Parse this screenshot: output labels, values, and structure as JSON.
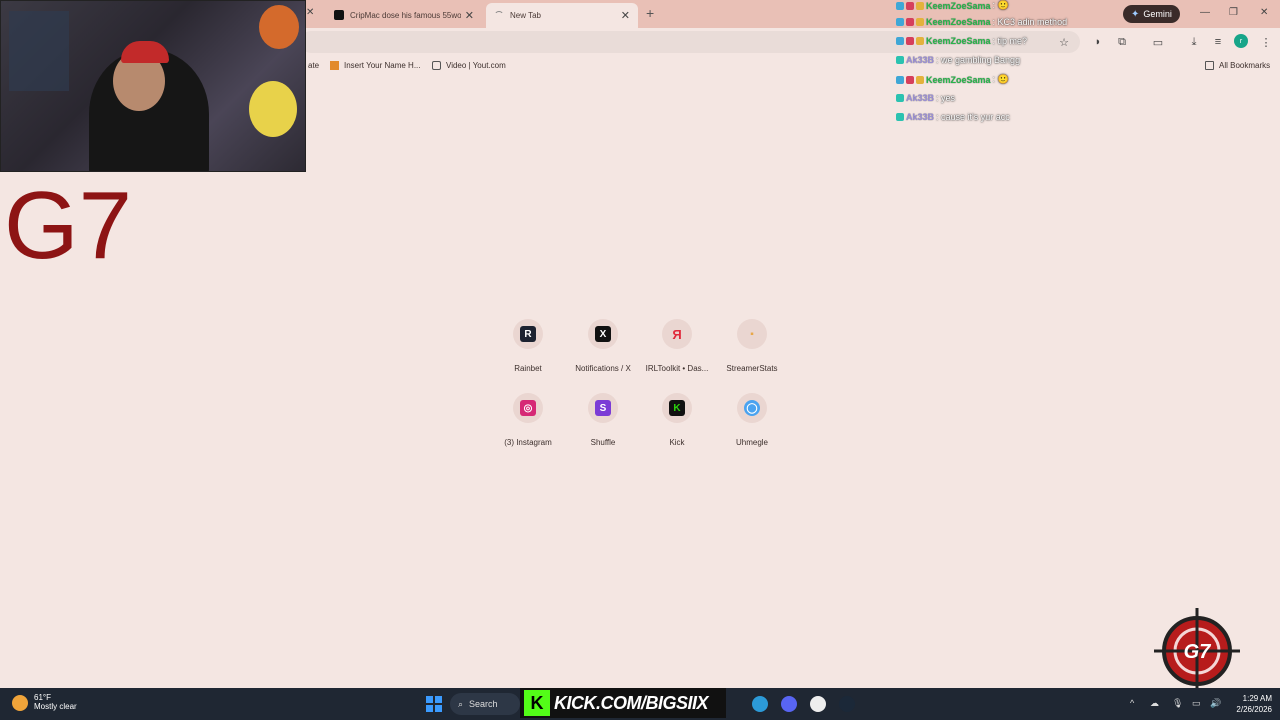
{
  "tabs": {
    "items": [
      {
        "title": "CripMac dose his famous 55wo",
        "close": "✕"
      },
      {
        "title": "New Tab",
        "close": "✕"
      }
    ],
    "new_tab": "+",
    "gemini_label": "Gemini"
  },
  "window_controls": [
    "—",
    "❐",
    "✕"
  ],
  "bookmarks": {
    "items": [
      {
        "label": "ate"
      },
      {
        "label": "Insert Your Name H..."
      },
      {
        "label": "Video | Yout.com"
      }
    ],
    "all_bookmarks": "All Bookmarks"
  },
  "overlay": {
    "title": "G7"
  },
  "chat": {
    "messages": [
      {
        "user": "KeemZoeSama",
        "text": ": 🙂",
        "color": "#27b64a"
      },
      {
        "user": "KeemZoeSama",
        "text": ": KC3 adin method",
        "color": "#27b64a"
      },
      {
        "user": "KeemZoeSama",
        "text": ": tip me?",
        "color": "#27b64a"
      },
      {
        "user": "Ak33B",
        "text": ": we gambling Bangg",
        "color": "#9b8fd6"
      },
      {
        "user": "KeemZoeSama",
        "text": ": 🙂",
        "color": "#27b64a"
      },
      {
        "user": "Ak33B",
        "text": ": yes",
        "color": "#9b8fd6"
      },
      {
        "user": "Ak33B",
        "text": ": cause it's yur acc",
        "color": "#9b8fd6"
      }
    ]
  },
  "shortcuts": [
    {
      "label": "Rainbet",
      "icon": "rainbet-icon",
      "glyph": "R",
      "color": "#1c2230"
    },
    {
      "label": "Notifications / X",
      "icon": "x-icon",
      "glyph": "X",
      "color": "#111111"
    },
    {
      "label": "IRLToolkit • Das...",
      "icon": "irltoolkit-icon",
      "glyph": "Я",
      "color": "#e02a3c"
    },
    {
      "label": "StreamerStats",
      "icon": "streamerstats-icon",
      "glyph": "▪",
      "color": "#f0c4b9"
    },
    {
      "label": "(3) Instagram",
      "icon": "instagram-icon",
      "glyph": "◎",
      "color": "#d62976"
    },
    {
      "label": "Shuffle",
      "icon": "shuffle-icon",
      "glyph": "S",
      "color": "#7b3bd6"
    },
    {
      "label": "Kick",
      "icon": "kick-icon",
      "glyph": "K",
      "color": "#2bd40d"
    },
    {
      "label": "Uhmegle",
      "icon": "uhmegle-icon",
      "glyph": "◯",
      "color": "#4aa3f0"
    }
  ],
  "taskbar": {
    "weather_temp": "61°F",
    "weather_desc": "Mostly clear",
    "search_label": "Search",
    "banner_text": "KICK.COM/BIGSIIX",
    "time": "1:29 AM",
    "date": "2/26/2026"
  }
}
